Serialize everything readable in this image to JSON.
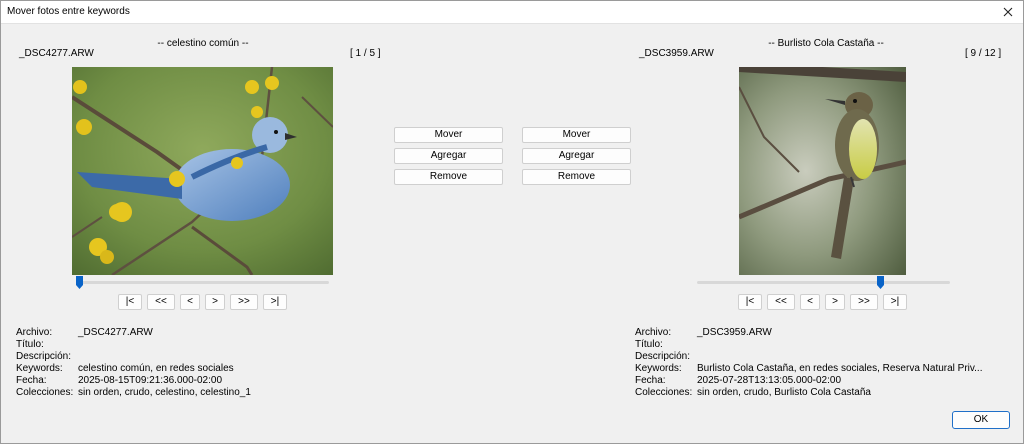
{
  "window": {
    "title": "Mover fotos entre keywords"
  },
  "left": {
    "keyword_header": "-- celestino común --",
    "filename": "_DSC4277.ARW",
    "counter": "[ 1 / 5 ]",
    "slider_fraction": 0.0,
    "info": {
      "archivo": "_DSC4277.ARW",
      "titulo": "",
      "descripcion": "",
      "keywords": "celestino común, en redes sociales",
      "fecha": "2025-08-15T09:21:36.000-02:00",
      "colecciones": "sin orden, crudo, celestino, celestino_1"
    }
  },
  "right": {
    "keyword_header": "-- Burlisto Cola Castaña --",
    "filename": "_DSC3959.ARW",
    "counter": "[ 9 / 12 ]",
    "slider_fraction": 0.73,
    "info": {
      "archivo": "_DSC3959.ARW",
      "titulo": "",
      "descripcion": "",
      "keywords": "Burlisto Cola Castaña, en redes sociales, Reserva Natural Priv...",
      "fecha": "2025-07-28T13:13:05.000-02:00",
      "colecciones": "sin orden, crudo, Burlisto Cola Castaña"
    }
  },
  "actions": {
    "left": {
      "move": "Mover",
      "add": "Agregar",
      "remove": "Remove"
    },
    "right": {
      "move": "Mover",
      "add": "Agregar",
      "remove": "Remove"
    }
  },
  "nav": {
    "first": "|<",
    "back_many": "<<",
    "back": "<",
    "forward": ">",
    "forward_many": ">>",
    "last": ">|"
  },
  "labels": {
    "archivo": "Archivo:",
    "titulo": "Título:",
    "descripcion": "Descripción:",
    "keywords": "Keywords:",
    "fecha": "Fecha:",
    "colecciones": "Colecciones:"
  },
  "ok_label": "OK",
  "colors": {
    "accent": "#1f6fc8",
    "slider_thumb": "#0a64c8"
  },
  "icons": {
    "close": "close-icon",
    "slider": "slider-thumb-icon"
  }
}
